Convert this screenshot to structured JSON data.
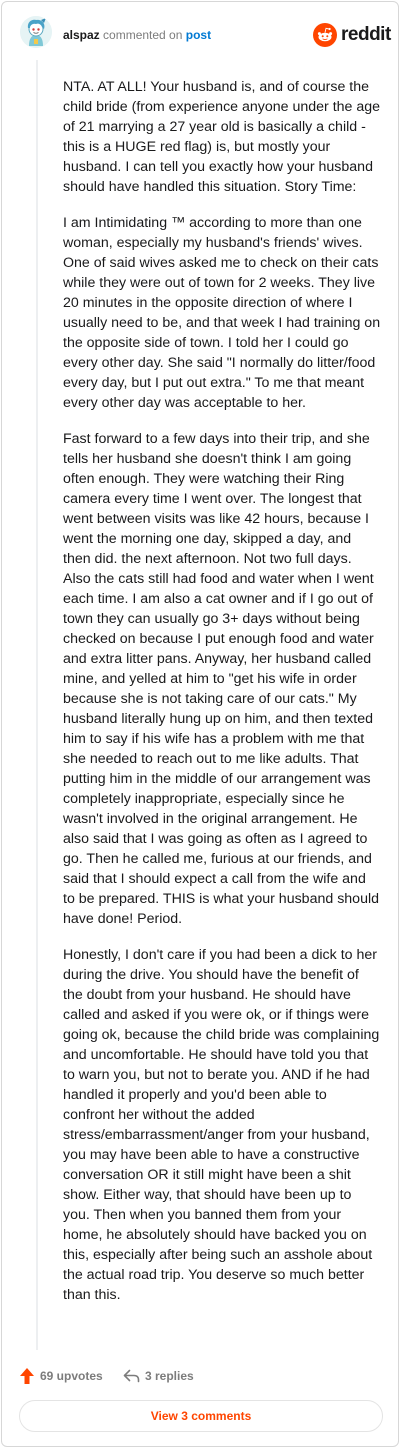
{
  "header": {
    "username": "alspaz",
    "verb": "commented on",
    "post_link": "post",
    "logo_text": "reddit"
  },
  "comment": {
    "paragraphs": [
      "NTA. AT ALL! Your husband is, and of course the child bride (from experience anyone under the age of 21 marrying a 27 year old is basically a child - this is a HUGE red flag) is, but mostly your husband. I can tell you exactly how your husband should have handled this situation. Story Time:",
      "I am Intimidating ™ according to more than one woman, especially my husband's friends' wives. One of said wives asked me to check on their cats while they were out of town for 2 weeks. They live 20 minutes in the opposite direction of where I usually need to be, and that week I had training on the opposite side of town. I told her I could go every other day. She said \"I normally do litter/food every day, but I put out extra.\" To me that meant every other day was acceptable to her.",
      "Fast forward to a few days into their trip, and she tells her husband she doesn't think I am going often enough. They were watching their Ring camera every time I went over. The longest that went between visits was like 42 hours, because I went the morning one day, skipped a day, and then did. the next afternoon. Not two full days. Also the cats still had food and water when I went each time. I am also a cat owner and if I go out of town they can usually go 3+ days without being checked on because I put enough food and water and extra litter pans. Anyway, her husband called mine, and yelled at him to \"get his wife in order because she is not taking care of our cats.\" My husband literally hung up on him, and then texted him to say if his wife has a problem with me that she needed to reach out to me like adults. That putting him in the middle of our arrangement was completely inappropriate, especially since he wasn't involved in the original arrangement. He also said that I was going as often as I agreed to go. Then he called me, furious at our friends, and said that I should expect a call from the wife and to be prepared. THIS is what your husband should have done! Period.",
      "Honestly, I don't care if you had been a dick to her during the drive. You should have the benefit of the doubt from your husband. He should have called and asked if you were ok, or if things were going ok, because the child bride was complaining and uncomfortable. He should have told you that to warn you, but not to berate you. AND if he had handled it properly and you'd been able to confront her without the added stress/embarrassment/anger from your husband, you may have been able to have a constructive conversation OR it still might have been a shit show. Either way, that should have been up to you. Then when you banned them from your home, he absolutely should have backed you on this, especially after being such an asshole about the actual road trip. You deserve so much better than this."
    ]
  },
  "footer": {
    "upvotes": "69 upvotes",
    "replies": "3 replies",
    "view_comments": "View 3 comments"
  },
  "colors": {
    "accent": "#ff4500",
    "link": "#0079d3",
    "muted": "#7c7c7c"
  },
  "icons": {
    "avatar": "snoo-avatar",
    "logo": "reddit-logo-icon",
    "upvote": "upvote-arrow-icon",
    "reply": "reply-arrow-icon"
  }
}
